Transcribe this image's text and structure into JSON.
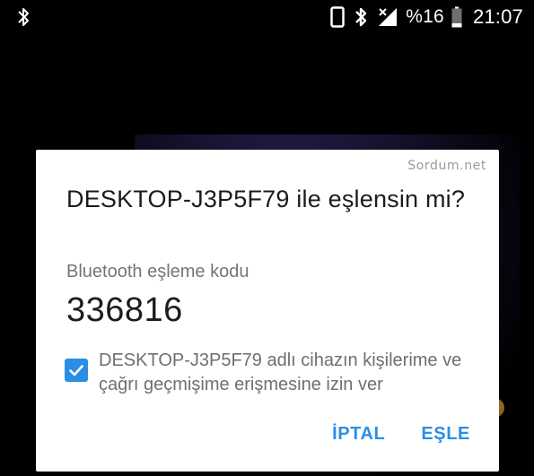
{
  "status_bar": {
    "left_icon": "bluetooth-icon",
    "icons": [
      "phone-icon",
      "bluetooth-icon",
      "signal-icon",
      "battery-icon"
    ],
    "battery_text": "%16",
    "time": "21:07"
  },
  "dialog": {
    "watermark": "Sordum.net",
    "title": "DESKTOP-J3P5F79 ile eşlensin mi?",
    "code_label": "Bluetooth eşleme kodu",
    "code_value": "336816",
    "checkbox": {
      "checked": true,
      "label": "DESKTOP-J3P5F79 adlı cihazın kişilerime ve çağrı geçmişime erişmesine izin ver"
    },
    "cancel_label": "İPTAL",
    "pair_label": "EŞLE"
  },
  "colors": {
    "accent": "#2a8ee6",
    "background": "#000000",
    "dialog": "#ffffff"
  }
}
